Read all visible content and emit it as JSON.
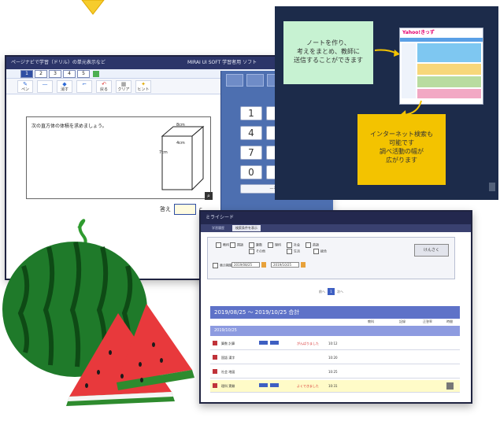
{
  "quiz": {
    "title": "ページナビで学習（ドリル）の単元表示など",
    "title_right": "MIRAI UI SOFT 学習者用 ソフト",
    "tabs": [
      "1",
      "2",
      "3",
      "4",
      "5"
    ],
    "tools": [
      {
        "icon": "pencil-icon",
        "label": "ペン"
      },
      {
        "icon": "line-icon",
        "label": ""
      },
      {
        "icon": "eraser-icon",
        "label": "消す"
      },
      {
        "icon": "cursor-icon",
        "label": ""
      },
      {
        "icon": "undo-icon",
        "label": "戻る"
      },
      {
        "icon": "clear-icon",
        "label": "クリア"
      },
      {
        "icon": "hint-icon",
        "label": "ヒント"
      }
    ],
    "question": "次の直方体の体積を求めましょう。",
    "dims": {
      "a": "8cm",
      "b": "4cm",
      "c": "7cm"
    },
    "answer_label": "答え"
  },
  "keypad": {
    "keys": [
      "1",
      "4",
      "7",
      "0"
    ],
    "wide_key": "—もどる"
  },
  "slide": {
    "note_text": [
      "ノートを作り、",
      "考えをまとめ、教師に",
      "送信することができます"
    ],
    "inet_text": [
      "インターネット検索も",
      "可能です",
      "調べ活動の幅が",
      "広がります"
    ],
    "site_name": "Yahoo!きっず",
    "colors": {
      "bg": "#1c2b4a",
      "note": "#c7f2d2",
      "inet": "#f3c300",
      "arrow": "#f3c300"
    }
  },
  "db": {
    "title": "ミライシード",
    "tabs": [
      "学習履歴",
      "検索条件を表示"
    ],
    "checks": [
      "国語",
      "算数",
      "理科",
      "社会",
      "英語",
      "その他",
      "生活",
      "総合"
    ],
    "search_button": "けんさく",
    "date_label": "表示期間",
    "date_from": "2019/08/25",
    "date_to": "2019/10/25",
    "pager": [
      "前へ",
      "1",
      "次へ"
    ],
    "summary_title": "2019/08/25 ～ 2019/10/25 合計",
    "cols": [
      "教科",
      "記録",
      "正答率",
      "時間"
    ],
    "day_label": "2019/10/25",
    "rows": [
      {
        "label": "算数 計算",
        "note": "がんばりました",
        "time": "10:12"
      },
      {
        "label": "国語 漢字",
        "note": "",
        "time": "10:20"
      },
      {
        "label": "社会 地図",
        "note": "",
        "time": "10:25"
      },
      {
        "label": "理科 実験",
        "note": "よくできました",
        "time": "10:31"
      }
    ]
  }
}
